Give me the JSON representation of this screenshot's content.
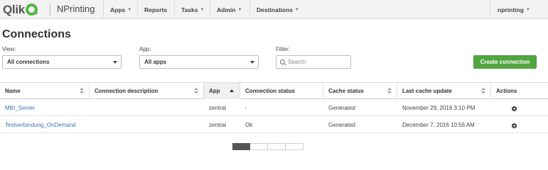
{
  "nav": {
    "brand": "Qlik",
    "product": "NPrinting",
    "items": [
      {
        "label": "Apps",
        "caret": true
      },
      {
        "label": "Reports",
        "caret": false
      },
      {
        "label": "Tasks",
        "caret": true
      },
      {
        "label": "Admin",
        "caret": true
      },
      {
        "label": "Destinations",
        "caret": true
      }
    ],
    "user": "nprinting"
  },
  "page": {
    "title": "Connections"
  },
  "filters": {
    "view_label": "View:",
    "view_value": "All connections",
    "app_label": "App:",
    "app_value": "All apps",
    "filter_label": "Filter:",
    "search_placeholder": "Search"
  },
  "actions": {
    "create_label": "Create connection"
  },
  "table": {
    "columns": [
      "Name",
      "Connection description",
      "App",
      "Connection status",
      "Cache status",
      "Last cache update",
      "Actions"
    ],
    "rows": [
      {
        "name": "MBI_Server",
        "description": "",
        "app": "zentral",
        "status": "-",
        "cache": "Generated",
        "updated": "November 29, 2016 3:10 PM",
        "action_icon": "gear-icon"
      },
      {
        "name": "Testverbindung_OnDemand",
        "description": "",
        "app": "zentral",
        "status": "Ok",
        "cache": "Generated",
        "updated": "December 7, 2016 10:56 AM",
        "action_icon": "gear-icon"
      }
    ]
  },
  "colors": {
    "accent_green": "#52a640",
    "link_blue": "#3b73b9",
    "nav_bg": "#f3f3f3"
  }
}
